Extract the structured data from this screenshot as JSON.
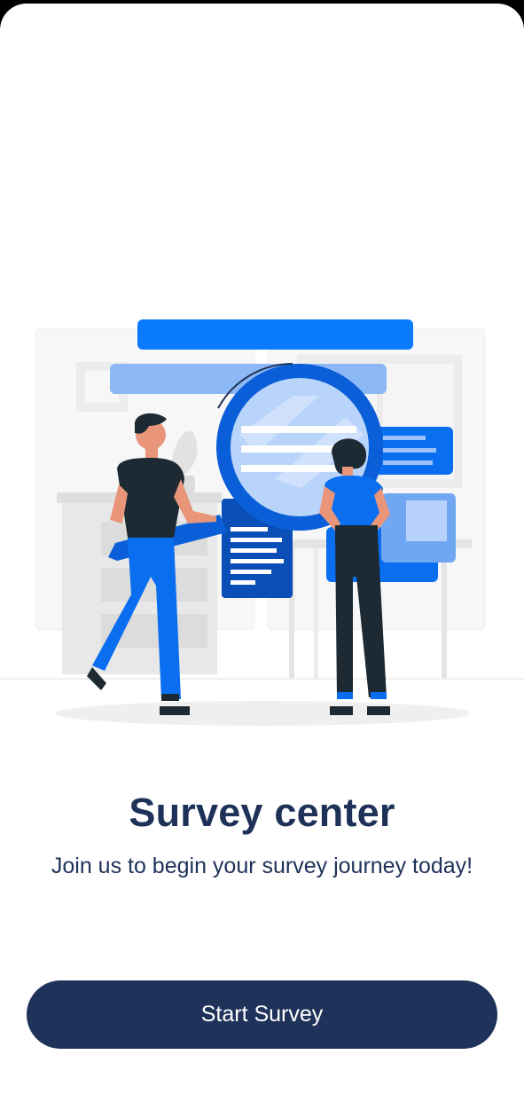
{
  "main": {
    "title": "Survey center",
    "subtitle": "Join us to begin your survey journey today!",
    "start_button_label": "Start Survey"
  },
  "colors": {
    "primary_dark": "#1f3259",
    "accent_blue": "#0a7aff",
    "light_blue": "#7fb3f5"
  },
  "illustration": {
    "icon": "survey-search-illustration"
  }
}
